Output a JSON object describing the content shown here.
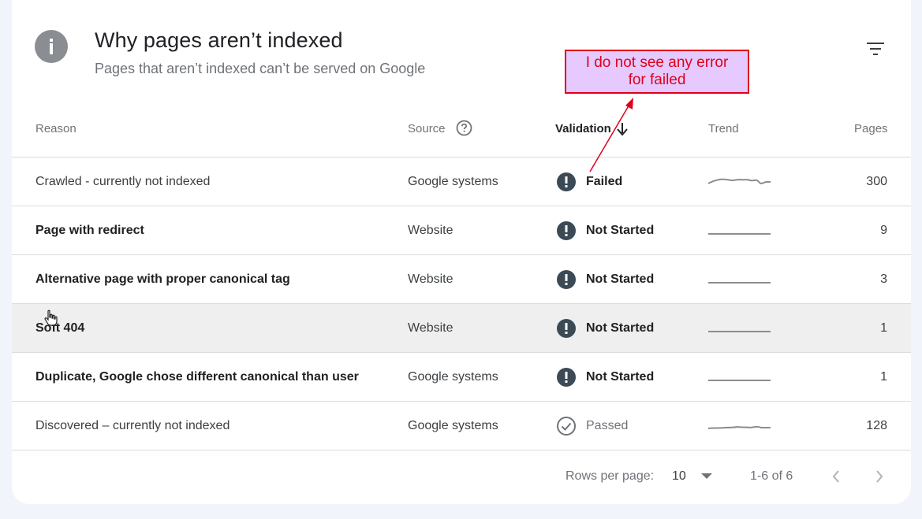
{
  "header": {
    "title": "Why pages aren’t indexed",
    "subtitle": "Pages that aren’t indexed can’t be served on Google",
    "info_icon": "info-icon",
    "filter_icon": "filter-icon"
  },
  "columns": {
    "reason": "Reason",
    "source": "Source",
    "validation": "Validation",
    "trend": "Trend",
    "pages": "Pages"
  },
  "rows": [
    {
      "reason": "Crawled - currently not indexed",
      "source": "Google systems",
      "validation": "Failed",
      "pages": "300",
      "status": "error",
      "bold": false
    },
    {
      "reason": "Page with redirect",
      "source": "Website",
      "validation": "Not Started",
      "pages": "9",
      "status": "error",
      "bold": true
    },
    {
      "reason": "Alternative page with proper canonical tag",
      "source": "Website",
      "validation": "Not Started",
      "pages": "3",
      "status": "error",
      "bold": true
    },
    {
      "reason": "Soft 404",
      "source": "Website",
      "validation": "Not Started",
      "pages": "1",
      "status": "error",
      "bold": true
    },
    {
      "reason": "Duplicate, Google chose different canonical than user",
      "source": "Google systems",
      "validation": "Not Started",
      "pages": "1",
      "status": "error",
      "bold": true
    },
    {
      "reason": "Discovered – currently not indexed",
      "source": "Google systems",
      "validation": "Passed",
      "pages": "128",
      "status": "passed",
      "bold": false
    }
  ],
  "footer": {
    "rows_per_page_label": "Rows per page:",
    "rows_per_page_value": "10",
    "range": "1-6 of 6"
  },
  "annotation": {
    "text_line1": "I do  not see any error",
    "text_line2": "for failed"
  },
  "colors": {
    "background": "#f1f4fb",
    "error_icon": "#3c4a56",
    "annotation_border": "#e0001b",
    "annotation_fill": "#e5c9ff"
  }
}
